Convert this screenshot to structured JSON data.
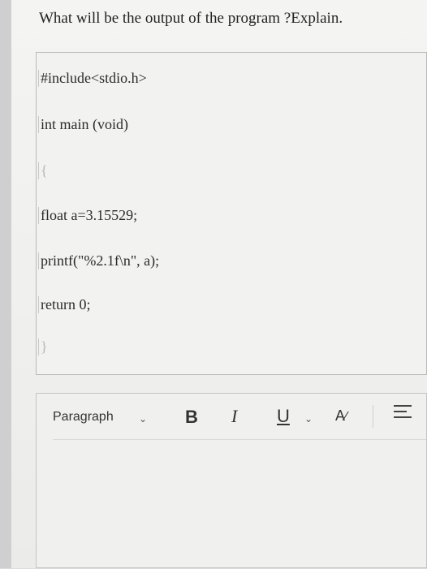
{
  "question": "What will be the output of the program ?Explain.",
  "code": {
    "line1": "#include<stdio.h>",
    "line2": "int main (void)",
    "line3": "{",
    "line4": "float a=3.15529;",
    "line5": "printf(\"%2.1f\\n\", a);",
    "line6": "return 0;",
    "line7": "}"
  },
  "toolbar": {
    "paragraph_label": "Paragraph",
    "bold_label": "B",
    "italic_label": "I",
    "underline_label": "U",
    "text_color_label": "A",
    "icons": [
      "chevron-down-icon",
      "align-icon"
    ]
  }
}
